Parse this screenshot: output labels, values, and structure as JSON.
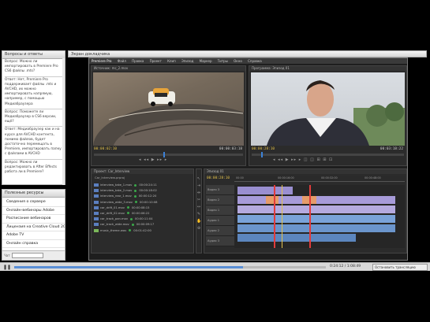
{
  "questions_panel": {
    "title": "Вопросы и ответы",
    "entries": [
      "Вопрос: Можно ли импортировать в Premiere Pro CS6 файлы .mts?",
      "Ответ: Нет, Premiere Pro поддерживает файлы .mts и AVCHD, их можно импортировать напрямую, например, с помощью Медиабраузера",
      "Вопрос: Поможете ли Медиабраузер в CS6 версии, ещё?",
      "Ответ: Медиабраузер как и на курсе для AVCHD контента, помимо файлов, будет достаточно перемещать в Premiere, импортировать папку с файлами в AVCHD",
      "Вопрос: Можно ли редактировать в After Effects работа ли в Premiere?"
    ]
  },
  "links_panel": {
    "title": "Полезные ресурсы",
    "items": [
      "Сведения о сервере",
      "Онлайн-вебинары Adobe",
      "Расписание вебинаров",
      "Лицензия на Creative Cloud 2012",
      "Adobe TV",
      "Онлайн справка"
    ],
    "input_label": "Чат"
  },
  "presenter": {
    "title": "Экран докладчика"
  },
  "app": {
    "title": "Premiere Pro",
    "menu": [
      "Файл",
      "Правка",
      "Проект",
      "Клип",
      "Эпизод",
      "Маркер",
      "Титры",
      "Окно",
      "Справка"
    ]
  },
  "source_monitor": {
    "tab": "Источник: mc_2.mov",
    "timecode_in": "00:00:02:10",
    "timecode_dur": "00:00:03:18"
  },
  "program_monitor": {
    "tab": "Программа: Эпизод 01",
    "timecode_in": "00:00:28:10",
    "timecode_dur": "00:03:18:22"
  },
  "project_panel": {
    "tab": "Проект: Car_Interview",
    "file": "Car_Interview.prproj",
    "items": [
      {
        "name": "interview_take_1.mov",
        "dur": "00:00:24:11"
      },
      {
        "name": "interview_take_2.mov",
        "dur": "00:00:18:02"
      },
      {
        "name": "interview_rear_1.mov",
        "dur": "00:00:12:20"
      },
      {
        "name": "interview_wide_3.mov",
        "dur": "00:00:10:08"
      },
      {
        "name": "car_drift_01.mov",
        "dur": "00:00:08:15"
      },
      {
        "name": "car_drift_02.mov",
        "dur": "00:00:06:22"
      },
      {
        "name": "car_track_pan.mov",
        "dur": "00:00:11:04"
      },
      {
        "name": "car_track_wide.mov",
        "dur": "00:00:09:17"
      },
      {
        "name": "music_theme.wav",
        "dur": "00:01:42:00"
      }
    ]
  },
  "timeline": {
    "tab": "Эпизод 01",
    "timecode": "00:00:28:10",
    "ruler": [
      "00:00",
      "00:00:16:00",
      "00:00:32:00",
      "00:00:48:00"
    ],
    "tracks": [
      "Видео 3",
      "Видео 2",
      "Видео 1",
      "Аудио 1",
      "Аудио 2",
      "Аудио 3"
    ]
  },
  "player": {
    "time": "0:24:12 / 1:08:49",
    "status": "Остановить трансляцию",
    "colors": {
      "accent": "#e3c14b",
      "progress": "#5a8fd6"
    }
  }
}
